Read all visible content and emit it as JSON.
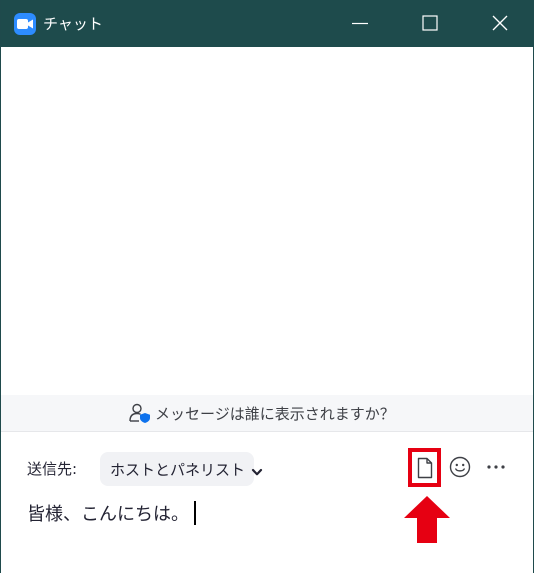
{
  "window": {
    "title": "チャット",
    "app_icon": "zoom-video-camera-icon",
    "controls": [
      "minimize-icon",
      "maximize-icon",
      "close-icon"
    ]
  },
  "banner": {
    "text": "メッセージは誰に表示されますか？",
    "icon": "person-shield-icon"
  },
  "compose": {
    "to_label": "送信先:",
    "recipient": "ホストとパネリスト",
    "recipient_icon": "chevron-down-icon",
    "toolbar_icons": [
      "file-icon",
      "emoji-icon",
      "more-icon"
    ],
    "message_text": "皆様、こんにちは。"
  },
  "colors": {
    "titlebar": "#1e4b4c",
    "app_icon": "#2d8cff",
    "banner_bg": "#f6f7f9",
    "dropdown_bg": "#f1f2f5",
    "highlight_red": "#e60012",
    "shield_blue": "#0e72ed"
  }
}
